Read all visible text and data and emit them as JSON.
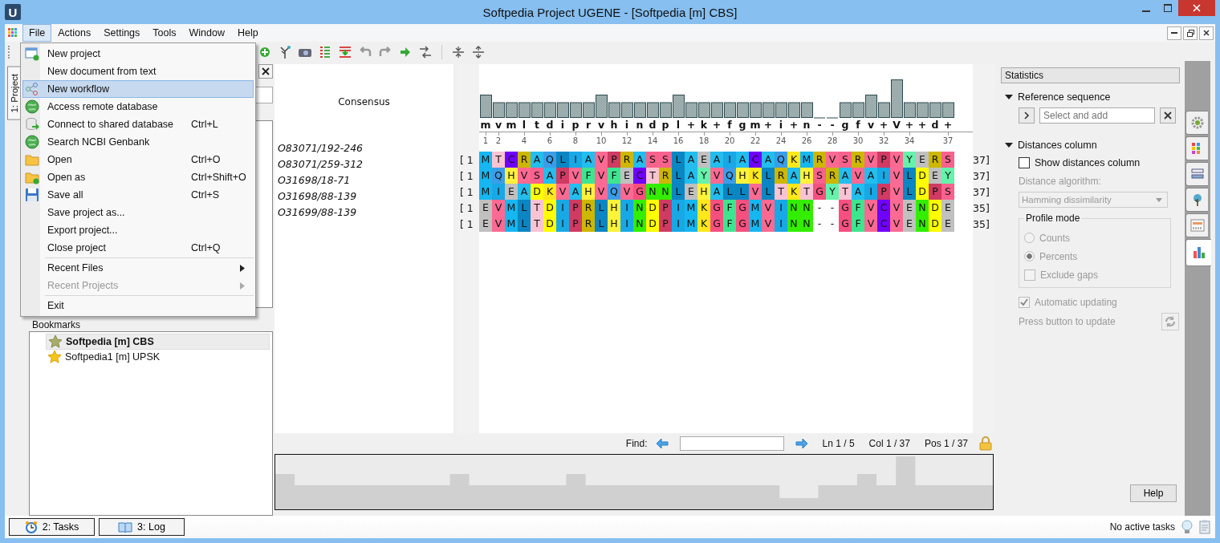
{
  "window": {
    "title": "Softpedia Project UGENE - [Softpedia [m] CBS]",
    "logo": "U"
  },
  "menu_bar": [
    {
      "label": "File",
      "selected": true
    },
    {
      "label": "Actions",
      "selected": false
    },
    {
      "label": "Settings",
      "selected": false
    },
    {
      "label": "Tools",
      "selected": false
    },
    {
      "label": "Window",
      "selected": false
    },
    {
      "label": "Help",
      "selected": false
    }
  ],
  "file_menu": {
    "groups": [
      [
        {
          "label": "New project",
          "selected": false,
          "disabled": false,
          "submenu": false
        },
        {
          "label": "New document from text",
          "selected": false,
          "disabled": false,
          "submenu": false
        },
        {
          "label": "New workflow",
          "selected": true,
          "disabled": false,
          "submenu": false
        },
        {
          "label": "Access remote database",
          "selected": false,
          "disabled": false,
          "submenu": false
        },
        {
          "label": "Connect to shared database",
          "shortcut": "Ctrl+L",
          "selected": false,
          "disabled": false,
          "submenu": false
        },
        {
          "label": "Search NCBI Genbank",
          "selected": false,
          "disabled": false,
          "submenu": false
        },
        {
          "label": "Open",
          "shortcut": "Ctrl+O",
          "selected": false,
          "disabled": false,
          "submenu": false
        },
        {
          "label": "Open as",
          "shortcut": "Ctrl+Shift+O",
          "selected": false,
          "disabled": false,
          "submenu": false
        },
        {
          "label": "Save all",
          "shortcut": "Ctrl+S",
          "selected": false,
          "disabled": false,
          "submenu": false
        },
        {
          "label": "Save project as...",
          "selected": false,
          "disabled": false,
          "submenu": false
        },
        {
          "label": "Export project...",
          "selected": false,
          "disabled": false,
          "submenu": false
        },
        {
          "label": "Close project",
          "shortcut": "Ctrl+Q",
          "selected": false,
          "disabled": false,
          "submenu": false
        }
      ],
      [
        {
          "label": "Recent Files",
          "selected": false,
          "disabled": false,
          "submenu": true
        },
        {
          "label": "Recent Projects",
          "selected": false,
          "disabled": true,
          "submenu": true
        }
      ],
      [
        {
          "label": "Exit",
          "selected": false,
          "disabled": false,
          "submenu": false
        }
      ]
    ]
  },
  "project_tab": {
    "label": "1: Project"
  },
  "bookmarks": {
    "label": "Bookmarks",
    "items": [
      {
        "label": "Softpedia [m] CBS",
        "selected": true
      },
      {
        "label": "Softpedia1 [m] UPSK",
        "selected": false
      }
    ]
  },
  "alignment": {
    "consensus_label": "Consensus",
    "consensus": [
      "m",
      "v",
      "m",
      "l",
      "t",
      "d",
      "i",
      "p",
      "r",
      "v",
      "h",
      "i",
      "n",
      "d",
      "p",
      "l",
      "+",
      "k",
      "+",
      "f",
      "g",
      "m",
      "+",
      "i",
      "+",
      "n",
      "-",
      "-",
      "g",
      "f",
      "v",
      "+",
      "V",
      "+",
      "+",
      "d",
      "+"
    ],
    "ruler": [
      "1",
      "2",
      "4",
      "6",
      "8",
      "10",
      "12",
      "14",
      "16",
      "18",
      "20",
      "22",
      "24",
      "26",
      "28",
      "30",
      "32",
      "34",
      "37"
    ],
    "rows": [
      {
        "name": "O83071/192-246",
        "start": "[ 1",
        "end": "37]",
        "residues": [
          {
            "residue": "M",
            "color": "#16b6f0"
          },
          {
            "residue": "T",
            "color": "#fac3d3"
          },
          {
            "residue": "C",
            "color": "#7000ff"
          },
          {
            "residue": "R",
            "color": "#cdb700"
          },
          {
            "residue": "A",
            "color": "#23bdee"
          },
          {
            "residue": "Q",
            "color": "#3b9de8"
          },
          {
            "residue": "L",
            "color": "#0b86c3"
          },
          {
            "residue": "I",
            "color": "#18a8e6"
          },
          {
            "residue": "A",
            "color": "#23bdee"
          },
          {
            "residue": "V",
            "color": "#fb6a92"
          },
          {
            "residue": "P",
            "color": "#cf3b63"
          },
          {
            "residue": "R",
            "color": "#cdb700"
          },
          {
            "residue": "A",
            "color": "#23bdee"
          },
          {
            "residue": "S",
            "color": "#f8628d"
          },
          {
            "residue": "S",
            "color": "#f8628d"
          },
          {
            "residue": "L",
            "color": "#0b86c3"
          },
          {
            "residue": "A",
            "color": "#23bdee"
          },
          {
            "residue": "E",
            "color": "#c0c0c0"
          },
          {
            "residue": "A",
            "color": "#23bdee"
          },
          {
            "residue": "I",
            "color": "#18a8e6"
          },
          {
            "residue": "A",
            "color": "#23bdee"
          },
          {
            "residue": "C",
            "color": "#7000ff"
          },
          {
            "residue": "A",
            "color": "#23bdee"
          },
          {
            "residue": "Q",
            "color": "#3b9de8"
          },
          {
            "residue": "K",
            "color": "#ffe81a"
          },
          {
            "residue": "M",
            "color": "#16b6f0"
          },
          {
            "residue": "R",
            "color": "#cdb700"
          },
          {
            "residue": "V",
            "color": "#fb6a92"
          },
          {
            "residue": "S",
            "color": "#f8628d"
          },
          {
            "residue": "R",
            "color": "#cdb700"
          },
          {
            "residue": "V",
            "color": "#fb6a92"
          },
          {
            "residue": "P",
            "color": "#cf3b63"
          },
          {
            "residue": "V",
            "color": "#fb6a92"
          },
          {
            "residue": "Y",
            "color": "#66f2aa"
          },
          {
            "residue": "E",
            "color": "#c0c0c0"
          },
          {
            "residue": "R",
            "color": "#cdb700"
          },
          {
            "residue": "S",
            "color": "#f8628d"
          }
        ]
      },
      {
        "name": "O83071/259-312",
        "start": "[ 1",
        "end": "37]",
        "residues": [
          {
            "residue": "M",
            "color": "#16b6f0"
          },
          {
            "residue": "Q",
            "color": "#3b9de8"
          },
          {
            "residue": "H",
            "color": "#fff23a"
          },
          {
            "residue": "V",
            "color": "#fb6a92"
          },
          {
            "residue": "S",
            "color": "#f8628d"
          },
          {
            "residue": "A",
            "color": "#23bdee"
          },
          {
            "residue": "P",
            "color": "#cf3b63"
          },
          {
            "residue": "V",
            "color": "#fb6a92"
          },
          {
            "residue": "F",
            "color": "#3ee58f"
          },
          {
            "residue": "V",
            "color": "#fb6a92"
          },
          {
            "residue": "F",
            "color": "#3ee58f"
          },
          {
            "residue": "E",
            "color": "#c0c0c0"
          },
          {
            "residue": "C",
            "color": "#7000ff"
          },
          {
            "residue": "T",
            "color": "#fac3d3"
          },
          {
            "residue": "R",
            "color": "#cdb700"
          },
          {
            "residue": "L",
            "color": "#0b86c3"
          },
          {
            "residue": "A",
            "color": "#23bdee"
          },
          {
            "residue": "Y",
            "color": "#66f2aa"
          },
          {
            "residue": "V",
            "color": "#fb6a92"
          },
          {
            "residue": "Q",
            "color": "#3b9de8"
          },
          {
            "residue": "H",
            "color": "#fff23a"
          },
          {
            "residue": "K",
            "color": "#ffe81a"
          },
          {
            "residue": "L",
            "color": "#0b86c3"
          },
          {
            "residue": "R",
            "color": "#cdb700"
          },
          {
            "residue": "A",
            "color": "#23bdee"
          },
          {
            "residue": "H",
            "color": "#fff23a"
          },
          {
            "residue": "S",
            "color": "#f8628d"
          },
          {
            "residue": "R",
            "color": "#cdb700"
          },
          {
            "residue": "A",
            "color": "#23bdee"
          },
          {
            "residue": "V",
            "color": "#fb6a92"
          },
          {
            "residue": "A",
            "color": "#23bdee"
          },
          {
            "residue": "I",
            "color": "#18a8e6"
          },
          {
            "residue": "V",
            "color": "#fb6a92"
          },
          {
            "residue": "L",
            "color": "#0b86c3"
          },
          {
            "residue": "D",
            "color": "#ffff00"
          },
          {
            "residue": "E",
            "color": "#c0c0c0"
          },
          {
            "residue": "Y",
            "color": "#66f2aa"
          }
        ]
      },
      {
        "name": "O31698/18-71",
        "start": "[ 1",
        "end": "37]",
        "residues": [
          {
            "residue": "M",
            "color": "#16b6f0"
          },
          {
            "residue": "I",
            "color": "#18a8e6"
          },
          {
            "residue": "E",
            "color": "#c0c0c0"
          },
          {
            "residue": "A",
            "color": "#23bdee"
          },
          {
            "residue": "D",
            "color": "#ffff00"
          },
          {
            "residue": "K",
            "color": "#ffe81a"
          },
          {
            "residue": "V",
            "color": "#fb6a92"
          },
          {
            "residue": "A",
            "color": "#23bdee"
          },
          {
            "residue": "H",
            "color": "#fff23a"
          },
          {
            "residue": "V",
            "color": "#fb6a92"
          },
          {
            "residue": "Q",
            "color": "#3b9de8"
          },
          {
            "residue": "V",
            "color": "#fb6a92"
          },
          {
            "residue": "G",
            "color": "#f6507f"
          },
          {
            "residue": "N",
            "color": "#33ee00"
          },
          {
            "residue": "N",
            "color": "#33ee00"
          },
          {
            "residue": "L",
            "color": "#0b86c3"
          },
          {
            "residue": "E",
            "color": "#c0c0c0"
          },
          {
            "residue": "H",
            "color": "#fff23a"
          },
          {
            "residue": "A",
            "color": "#23bdee"
          },
          {
            "residue": "L",
            "color": "#0b86c3"
          },
          {
            "residue": "L",
            "color": "#0b86c3"
          },
          {
            "residue": "V",
            "color": "#fb6a92"
          },
          {
            "residue": "L",
            "color": "#0b86c3"
          },
          {
            "residue": "T",
            "color": "#fac3d3"
          },
          {
            "residue": "K",
            "color": "#ffe81a"
          },
          {
            "residue": "T",
            "color": "#fac3d3"
          },
          {
            "residue": "G",
            "color": "#f6507f"
          },
          {
            "residue": "Y",
            "color": "#66f2aa"
          },
          {
            "residue": "T",
            "color": "#fac3d3"
          },
          {
            "residue": "A",
            "color": "#23bdee"
          },
          {
            "residue": "I",
            "color": "#18a8e6"
          },
          {
            "residue": "P",
            "color": "#cf3b63"
          },
          {
            "residue": "V",
            "color": "#fb6a92"
          },
          {
            "residue": "L",
            "color": "#0b86c3"
          },
          {
            "residue": "D",
            "color": "#ffff00"
          },
          {
            "residue": "P",
            "color": "#cf3b63"
          },
          {
            "residue": "S",
            "color": "#f8628d"
          }
        ]
      },
      {
        "name": "O31698/88-139",
        "start": "[ 1",
        "end": "35]",
        "residues": [
          {
            "residue": "E",
            "color": "#c0c0c0"
          },
          {
            "residue": "V",
            "color": "#fb6a92"
          },
          {
            "residue": "M",
            "color": "#16b6f0"
          },
          {
            "residue": "L",
            "color": "#0b86c3"
          },
          {
            "residue": "T",
            "color": "#fac3d3"
          },
          {
            "residue": "D",
            "color": "#ffff00"
          },
          {
            "residue": "I",
            "color": "#18a8e6"
          },
          {
            "residue": "P",
            "color": "#cf3b63"
          },
          {
            "residue": "R",
            "color": "#cdb700"
          },
          {
            "residue": "L",
            "color": "#0b86c3"
          },
          {
            "residue": "H",
            "color": "#fff23a"
          },
          {
            "residue": "I",
            "color": "#18a8e6"
          },
          {
            "residue": "N",
            "color": "#33ee00"
          },
          {
            "residue": "D",
            "color": "#ffff00"
          },
          {
            "residue": "P",
            "color": "#cf3b63"
          },
          {
            "residue": "I",
            "color": "#18a8e6"
          },
          {
            "residue": "M",
            "color": "#16b6f0"
          },
          {
            "residue": "K",
            "color": "#ffe81a"
          },
          {
            "residue": "G",
            "color": "#f6507f"
          },
          {
            "residue": "F",
            "color": "#3ee58f"
          },
          {
            "residue": "G",
            "color": "#f6507f"
          },
          {
            "residue": "M",
            "color": "#16b6f0"
          },
          {
            "residue": "V",
            "color": "#fb6a92"
          },
          {
            "residue": "I",
            "color": "#18a8e6"
          },
          {
            "residue": "N",
            "color": "#33ee00"
          },
          {
            "residue": "N",
            "color": "#33ee00"
          },
          {
            "residue": "-"
          },
          {
            "residue": "-"
          },
          {
            "residue": "G",
            "color": "#f6507f"
          },
          {
            "residue": "F",
            "color": "#3ee58f"
          },
          {
            "residue": "V",
            "color": "#fb6a92"
          },
          {
            "residue": "C",
            "color": "#7000ff"
          },
          {
            "residue": "V",
            "color": "#fb6a92"
          },
          {
            "residue": "E",
            "color": "#c0c0c0"
          },
          {
            "residue": "N",
            "color": "#33ee00"
          },
          {
            "residue": "D",
            "color": "#ffff00"
          },
          {
            "residue": "E",
            "color": "#c0c0c0"
          }
        ]
      },
      {
        "name": "O31699/88-139",
        "start": "[ 1",
        "end": "35]",
        "residues": [
          {
            "residue": "E",
            "color": "#c0c0c0"
          },
          {
            "residue": "V",
            "color": "#fb6a92"
          },
          {
            "residue": "M",
            "color": "#16b6f0"
          },
          {
            "residue": "L",
            "color": "#0b86c3"
          },
          {
            "residue": "T",
            "color": "#fac3d3"
          },
          {
            "residue": "D",
            "color": "#ffff00"
          },
          {
            "residue": "I",
            "color": "#18a8e6"
          },
          {
            "residue": "P",
            "color": "#cf3b63"
          },
          {
            "residue": "R",
            "color": "#cdb700"
          },
          {
            "residue": "L",
            "color": "#0b86c3"
          },
          {
            "residue": "H",
            "color": "#fff23a"
          },
          {
            "residue": "I",
            "color": "#18a8e6"
          },
          {
            "residue": "N",
            "color": "#33ee00"
          },
          {
            "residue": "D",
            "color": "#ffff00"
          },
          {
            "residue": "P",
            "color": "#cf3b63"
          },
          {
            "residue": "I",
            "color": "#18a8e6"
          },
          {
            "residue": "M",
            "color": "#16b6f0"
          },
          {
            "residue": "K",
            "color": "#ffe81a"
          },
          {
            "residue": "G",
            "color": "#f6507f"
          },
          {
            "residue": "F",
            "color": "#3ee58f"
          },
          {
            "residue": "G",
            "color": "#f6507f"
          },
          {
            "residue": "M",
            "color": "#16b6f0"
          },
          {
            "residue": "V",
            "color": "#fb6a92"
          },
          {
            "residue": "I",
            "color": "#18a8e6"
          },
          {
            "residue": "N",
            "color": "#33ee00"
          },
          {
            "residue": "N",
            "color": "#33ee00"
          },
          {
            "residue": "-"
          },
          {
            "residue": "-"
          },
          {
            "residue": "G",
            "color": "#f6507f"
          },
          {
            "residue": "F",
            "color": "#3ee58f"
          },
          {
            "residue": "V",
            "color": "#fb6a92"
          },
          {
            "residue": "C",
            "color": "#7000ff"
          },
          {
            "residue": "V",
            "color": "#fb6a92"
          },
          {
            "residue": "E",
            "color": "#c0c0c0"
          },
          {
            "residue": "N",
            "color": "#33ee00"
          },
          {
            "residue": "D",
            "color": "#ffff00"
          },
          {
            "residue": "E",
            "color": "#c0c0c0"
          }
        ]
      }
    ]
  },
  "find_bar": {
    "label": "Find:",
    "line": "Ln 1 / 5",
    "column": "Col 1 / 37",
    "position": "Pos 1 / 37"
  },
  "statistics": {
    "title": "Statistics",
    "reference": {
      "title": "Reference sequence",
      "expanded": true,
      "placeholder": "Select and add"
    },
    "distances": {
      "title": "Distances column",
      "expanded": true,
      "show_label": "Show distances column",
      "show_checked": false,
      "algorithm_label": "Distance algorithm:",
      "algorithm": "Hamming dissimilarity",
      "disabled": true
    },
    "profile": {
      "title": "Profile mode",
      "options": [
        {
          "label": "Counts",
          "selected": false
        },
        {
          "label": "Percents",
          "selected": true
        }
      ],
      "exclude_gaps": {
        "label": "Exclude gaps",
        "checked": false
      }
    },
    "auto_update": {
      "label": "Automatic updating",
      "checked": true
    },
    "update_label": "Press button to update",
    "help": "Help"
  },
  "side_tabs": [
    {
      "selected": false
    },
    {
      "selected": false
    },
    {
      "selected": false
    },
    {
      "selected": false
    },
    {
      "selected": false
    },
    {
      "selected": true
    }
  ],
  "bottom_tabs": [
    {
      "label": "2: Tasks"
    },
    {
      "label": "3: Log"
    }
  ],
  "status": "No active tasks"
}
